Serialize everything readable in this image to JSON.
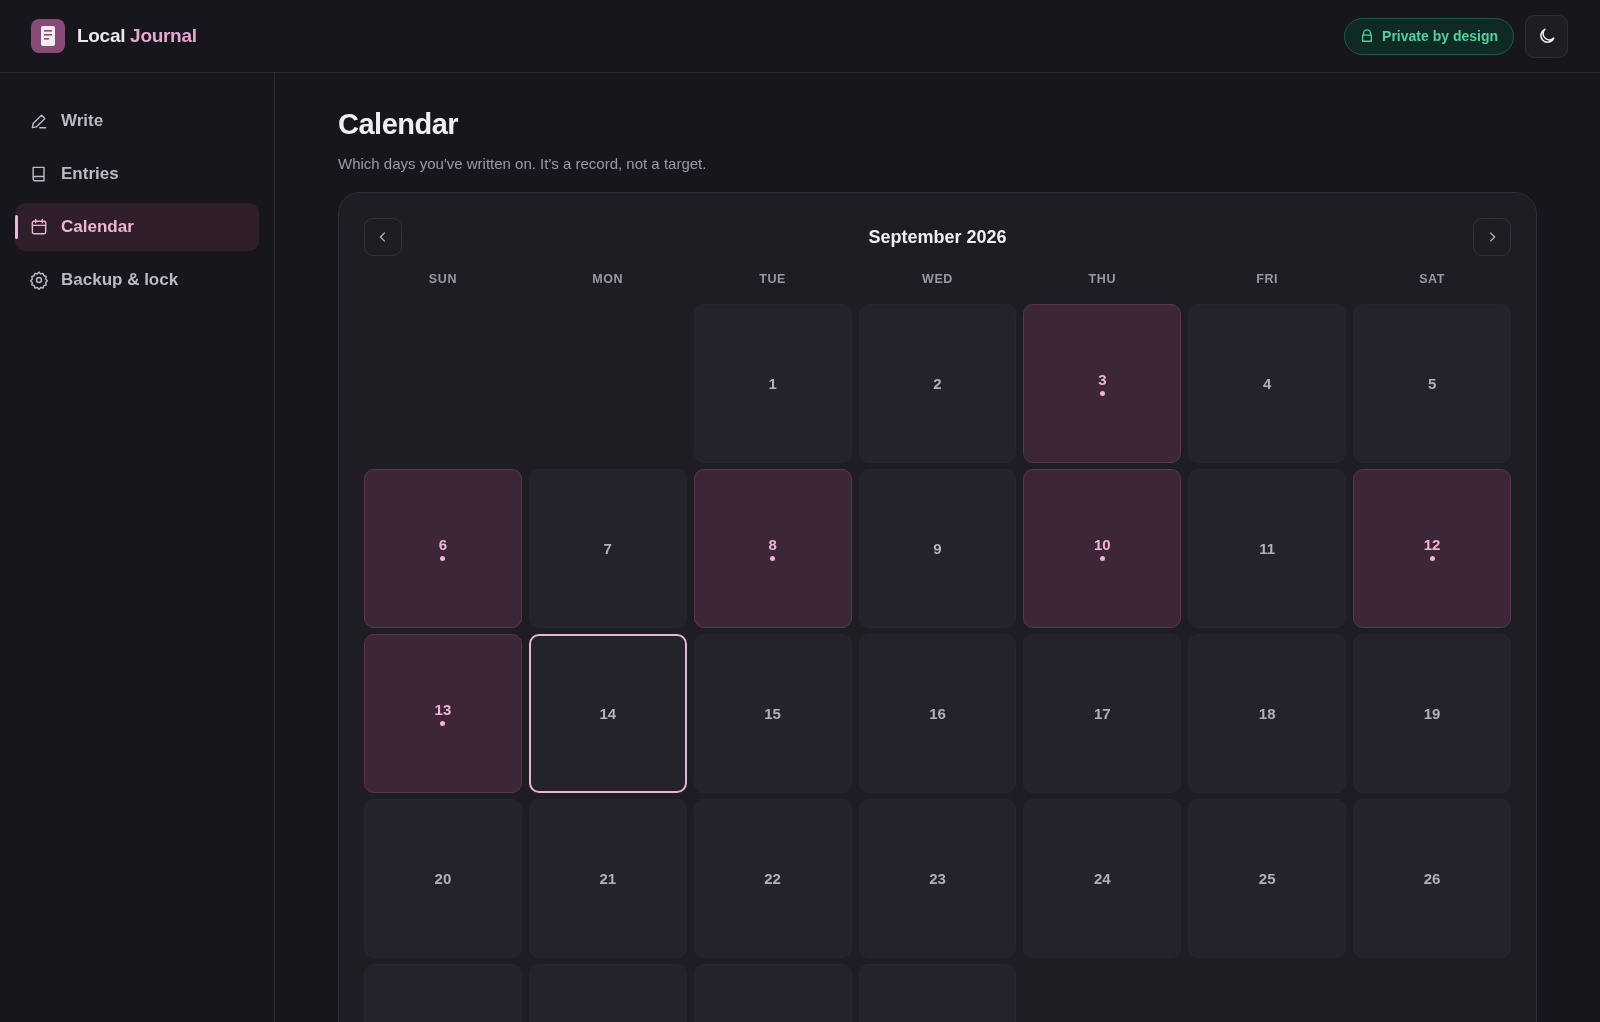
{
  "brand": {
    "first": "Local",
    "second": "Journal"
  },
  "privacy_badge": "Private by design",
  "nav": [
    {
      "label": "Write",
      "selected": false
    },
    {
      "label": "Entries",
      "selected": false
    },
    {
      "label": "Calendar",
      "selected": true
    },
    {
      "label": "Backup & lock",
      "selected": false
    }
  ],
  "page": {
    "title": "Calendar",
    "subtitle": "Which days you've written on. It's a record, not a target."
  },
  "calendar": {
    "month": "September 2026",
    "weekdays": [
      "SUN",
      "MON",
      "TUE",
      "WED",
      "THU",
      "FRI",
      "SAT"
    ],
    "cells": [
      {
        "kind": "blank"
      },
      {
        "kind": "blank"
      },
      {
        "kind": "day",
        "day": "1",
        "written": false,
        "today": false
      },
      {
        "kind": "day",
        "day": "2",
        "written": false,
        "today": false
      },
      {
        "kind": "day",
        "day": "3",
        "written": true,
        "today": false
      },
      {
        "kind": "day",
        "day": "4",
        "written": false,
        "today": false
      },
      {
        "kind": "day",
        "day": "5",
        "written": false,
        "today": false
      },
      {
        "kind": "day",
        "day": "6",
        "written": true,
        "today": false
      },
      {
        "kind": "day",
        "day": "7",
        "written": false,
        "today": false
      },
      {
        "kind": "day",
        "day": "8",
        "written": true,
        "today": false
      },
      {
        "kind": "day",
        "day": "9",
        "written": false,
        "today": false
      },
      {
        "kind": "day",
        "day": "10",
        "written": true,
        "today": false
      },
      {
        "kind": "day",
        "day": "11",
        "written": false,
        "today": false
      },
      {
        "kind": "day",
        "day": "12",
        "written": true,
        "today": false
      },
      {
        "kind": "day",
        "day": "13",
        "written": true,
        "today": false
      },
      {
        "kind": "day",
        "day": "14",
        "written": false,
        "today": true
      },
      {
        "kind": "day",
        "day": "15",
        "written": false,
        "today": false
      },
      {
        "kind": "day",
        "day": "16",
        "written": false,
        "today": false
      },
      {
        "kind": "day",
        "day": "17",
        "written": false,
        "today": false
      },
      {
        "kind": "day",
        "day": "18",
        "written": false,
        "today": false
      },
      {
        "kind": "day",
        "day": "19",
        "written": false,
        "today": false
      },
      {
        "kind": "day",
        "day": "20",
        "written": false,
        "today": false
      },
      {
        "kind": "day",
        "day": "21",
        "written": false,
        "today": false
      },
      {
        "kind": "day",
        "day": "22",
        "written": false,
        "today": false
      },
      {
        "kind": "day",
        "day": "23",
        "written": false,
        "today": false
      },
      {
        "kind": "day",
        "day": "24",
        "written": false,
        "today": false
      },
      {
        "kind": "day",
        "day": "25",
        "written": false,
        "today": false
      },
      {
        "kind": "day",
        "day": "26",
        "written": false,
        "today": false
      },
      {
        "kind": "cutoff"
      },
      {
        "kind": "cutoff"
      },
      {
        "kind": "cutoff"
      },
      {
        "kind": "cutoff"
      }
    ]
  }
}
